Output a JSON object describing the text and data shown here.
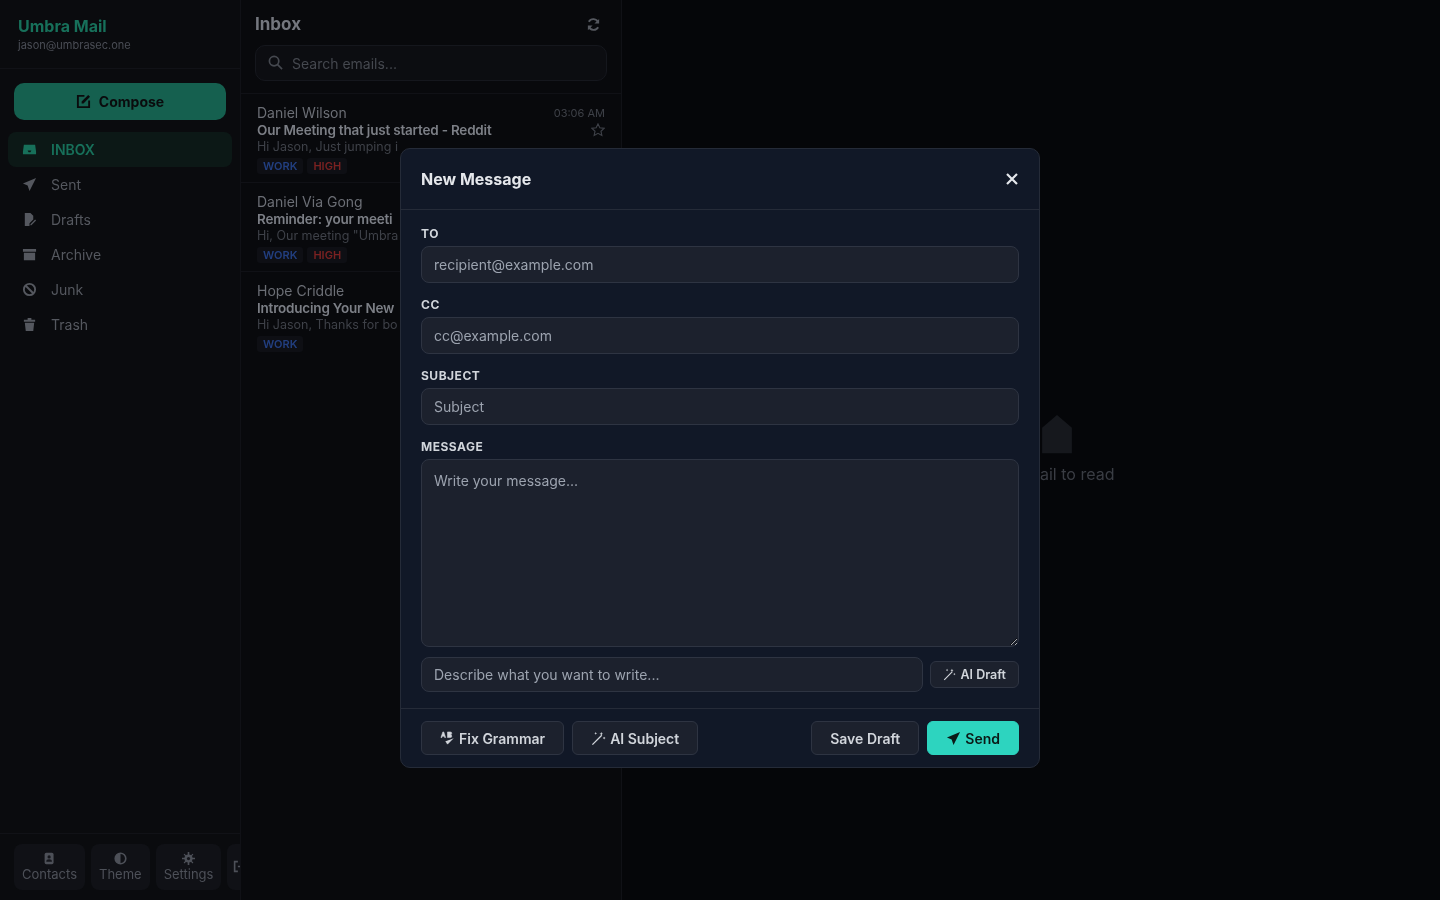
{
  "app": {
    "name": "Umbra Mail",
    "account": "jason@umbrasec.one"
  },
  "compose_button": "Compose",
  "folders": [
    {
      "label": "INBOX",
      "selected": true
    },
    {
      "label": "Sent",
      "selected": false
    },
    {
      "label": "Drafts",
      "selected": false
    },
    {
      "label": "Archive",
      "selected": false
    },
    {
      "label": "Junk",
      "selected": false
    },
    {
      "label": "Trash",
      "selected": false
    }
  ],
  "footer_buttons": [
    "Contacts",
    "Theme",
    "Settings"
  ],
  "list": {
    "title": "Inbox",
    "search": {
      "placeholder": "Search emails..."
    },
    "emails": [
      {
        "sender": "Daniel Wilson",
        "time": "03:06 AM",
        "starred": false,
        "subject": "Our Meeting that just started - Reddit",
        "preview": "Hi Jason, Just jumping i",
        "tags": [
          {
            "label": "WORK",
            "color": "#223f80"
          },
          {
            "label": "HIGH",
            "color": "#7a2121"
          }
        ]
      },
      {
        "sender": "Daniel Via Gong",
        "subject": "Reminder: your meeti",
        "preview": "Hi, Our meeting \"Umbra",
        "tags": [
          {
            "label": "WORK",
            "color": "#223f80"
          },
          {
            "label": "HIGH",
            "color": "#7a2121"
          }
        ]
      },
      {
        "sender": "Hope Criddle",
        "subject": "Introducing Your New",
        "preview": "Hi Jason, Thanks for bo",
        "tags": [
          {
            "label": "WORK",
            "color": "#223f80"
          }
        ]
      }
    ]
  },
  "reading_pane": {
    "empty_text": "ail to read"
  },
  "modal": {
    "title": "New Message",
    "fields": [
      {
        "label": "TO",
        "placeholder": "recipient@example.com"
      },
      {
        "label": "CC",
        "placeholder": "cc@example.com"
      },
      {
        "label": "SUBJECT",
        "placeholder": "Subject"
      }
    ],
    "message": {
      "label": "MESSAGE",
      "placeholder": "Write your message..."
    },
    "ai_prompt": {
      "placeholder": "Describe what you want to write...",
      "button": "AI Draft"
    },
    "actions": [
      {
        "label": "Fix Grammar",
        "kind": "grammar"
      },
      {
        "label": "AI Subject",
        "kind": "magic"
      },
      {
        "label": "Save Draft",
        "kind": "plain"
      },
      {
        "label": "Send",
        "kind": "primary"
      }
    ]
  }
}
